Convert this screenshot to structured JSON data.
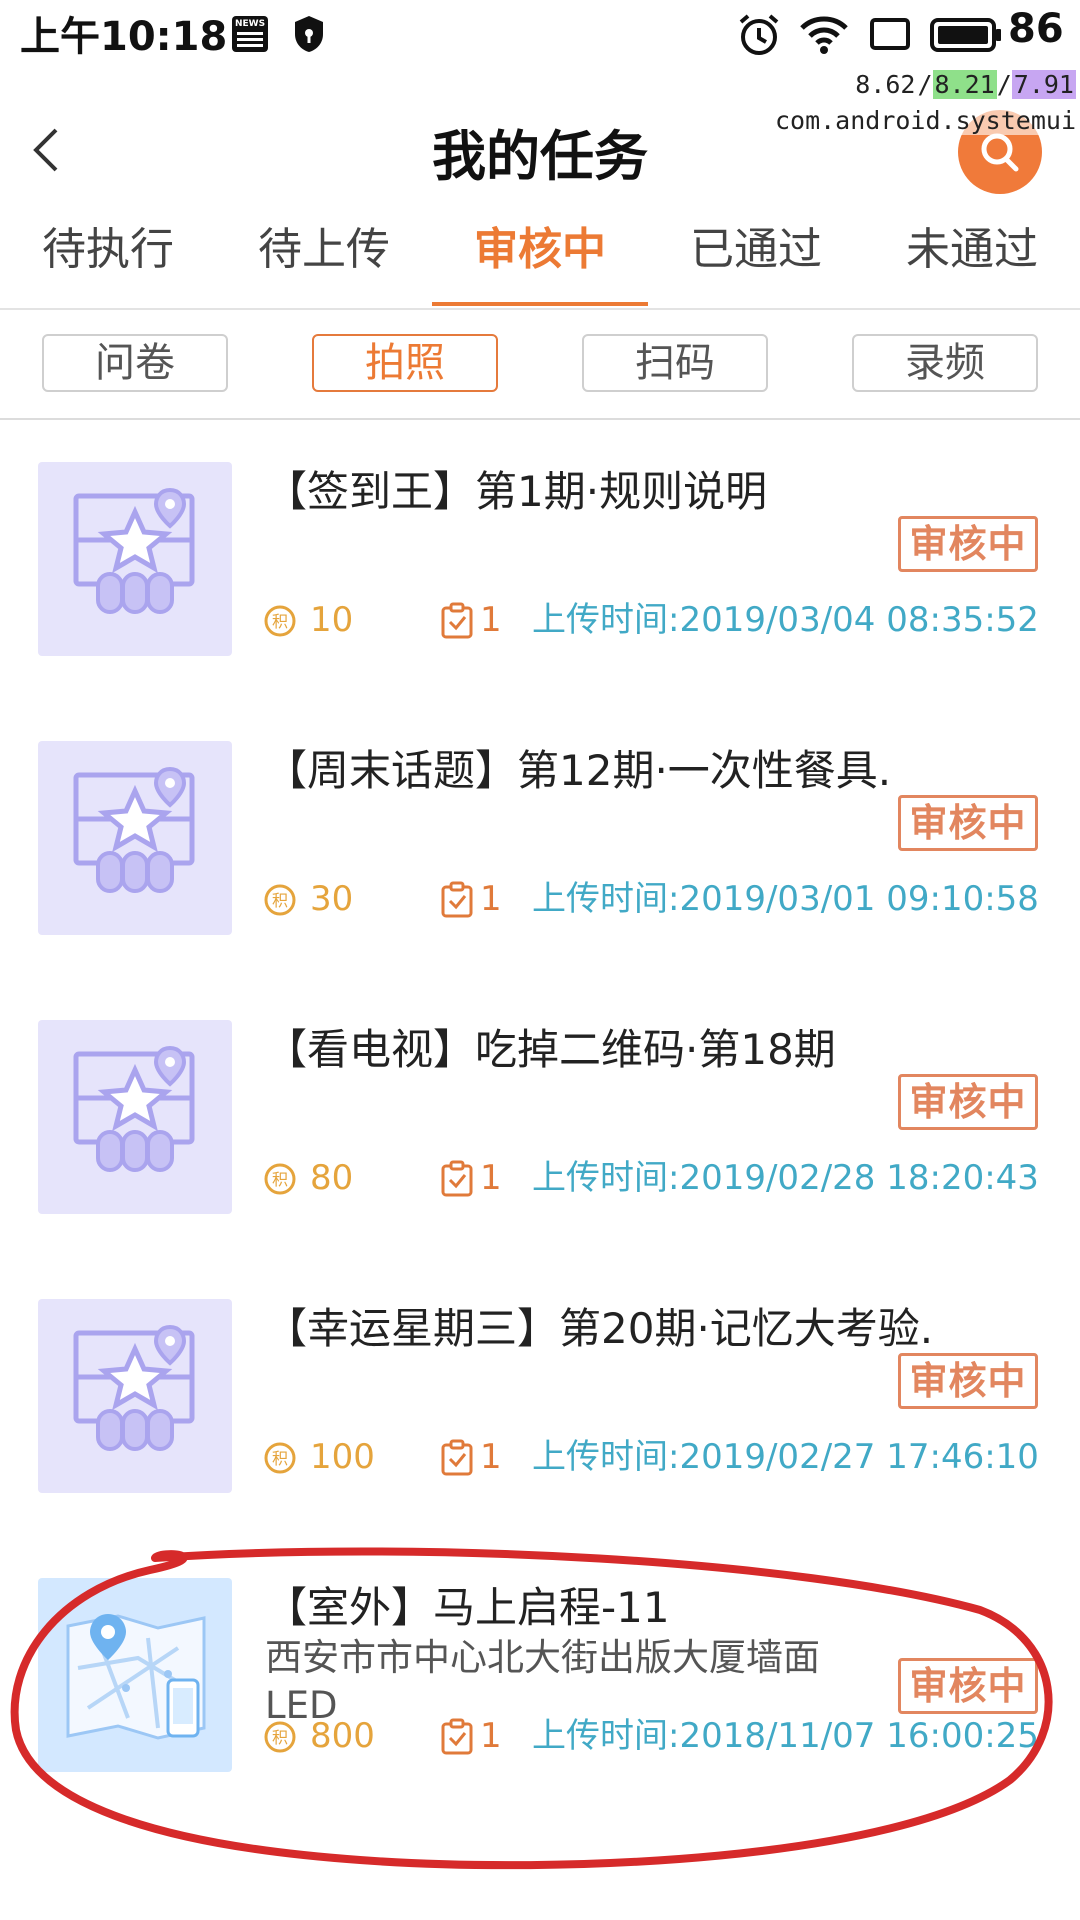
{
  "status_bar": {
    "time": "上午10:18",
    "news_icon_label": "NEWS",
    "battery_level": "86",
    "debug_stats": [
      "8.62",
      "8.21",
      "7.91"
    ],
    "debug_package": "com.android.systemui"
  },
  "header": {
    "title": "我的任务"
  },
  "tabs": [
    {
      "label": "待执行",
      "active": false
    },
    {
      "label": "待上传",
      "active": false
    },
    {
      "label": "审核中",
      "active": true
    },
    {
      "label": "已通过",
      "active": false
    },
    {
      "label": "未通过",
      "active": false
    }
  ],
  "filters": [
    {
      "label": "问卷",
      "active": false
    },
    {
      "label": "拍照",
      "active": true
    },
    {
      "label": "扫码",
      "active": false
    },
    {
      "label": "录频",
      "active": false
    }
  ],
  "tasks": [
    {
      "title": "【签到王】第1期·规则说明",
      "address": "",
      "status": "审核中",
      "points": "10",
      "count": "1",
      "upload_time": "上传时间:2019/03/04 08:35:52",
      "thumb": "reward-map-icon"
    },
    {
      "title": "【周末话题】第12期·一次性餐具.",
      "address": "",
      "status": "审核中",
      "points": "30",
      "count": "1",
      "upload_time": "上传时间:2019/03/01 09:10:58",
      "thumb": "reward-map-icon"
    },
    {
      "title": "【看电视】吃掉二维码·第18期",
      "address": "",
      "status": "审核中",
      "points": "80",
      "count": "1",
      "upload_time": "上传时间:2019/02/28 18:20:43",
      "thumb": "reward-map-icon"
    },
    {
      "title": "【幸运星期三】第20期·记忆大考验.",
      "address": "",
      "status": "审核中",
      "points": "100",
      "count": "1",
      "upload_time": "上传时间:2019/02/27 17:46:10",
      "thumb": "reward-map-icon"
    },
    {
      "title": "【室外】马上启程-11",
      "address": "西安市市中心北大街出版大厦墙面LED",
      "status": "审核中",
      "points": "800",
      "count": "1",
      "upload_time": "上传时间:2018/11/07 16:00:25",
      "thumb": "city-map-icon"
    }
  ],
  "colors": {
    "accent": "#ec7a34",
    "points": "#e5a43c",
    "time": "#41a9c6",
    "stamp": "#e2865f",
    "annotation": "#d62a2a"
  }
}
